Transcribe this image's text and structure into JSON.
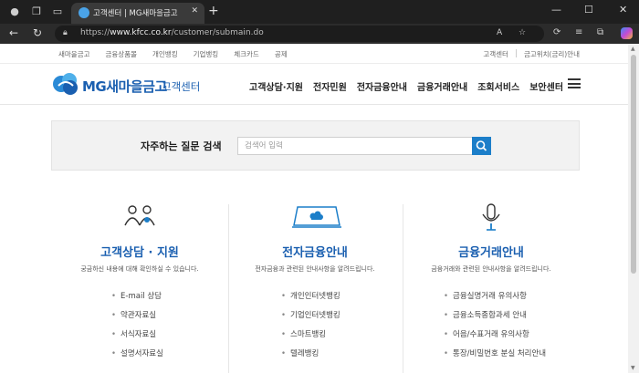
{
  "browser": {
    "tab_title": "고객센터 | MG새마을금고",
    "url_prefix": "https://",
    "url_host": "www.kfcc.co.kr",
    "url_path": "/customer/submain.do"
  },
  "utility_nav": {
    "left": [
      "새마을금고",
      "금융상품몰",
      "개인뱅킹",
      "기업뱅킹",
      "체크카드",
      "공제"
    ],
    "right": [
      "고객센터",
      "금고위치(금리)안내"
    ]
  },
  "header": {
    "logo_text": "MG새마을금고",
    "logo_sub": "고객센터",
    "nav": [
      "고객상담·지원",
      "전자민원",
      "전자금융안내",
      "금융거래안내",
      "조회서비스",
      "보안센터"
    ]
  },
  "faq_search": {
    "label": "자주하는 질문 검색",
    "placeholder": "검색어 입력"
  },
  "columns": [
    {
      "icon": "people-icon",
      "title": "고객상담 · 지원",
      "desc": "궁금하신 내용에 대해 확인하실 수 있습니다.",
      "items": [
        "E-mail 상담",
        "약관자료실",
        "서식자료실",
        "설명서자료실"
      ]
    },
    {
      "icon": "monitor-cloud-icon",
      "title": "전자금융안내",
      "desc": "전자금융과 관련된 안내사항을 알려드립니다.",
      "items": [
        "개인인터넷뱅킹",
        "기업인터넷뱅킹",
        "스마트뱅킹",
        "텔레뱅킹"
      ]
    },
    {
      "icon": "microphone-icon",
      "title": "금융거래안내",
      "desc": "금융거래와 관련된 안내사항을 알려드립니다.",
      "items": [
        "금융실명거래 유의사항",
        "금융소득종합과세 안내",
        "어음/수표거래 유의사항",
        "통장/비밀번호 분실 처리안내"
      ]
    }
  ],
  "colors": {
    "brand": "#1a5fb0",
    "search_button": "#1c7ec9"
  }
}
